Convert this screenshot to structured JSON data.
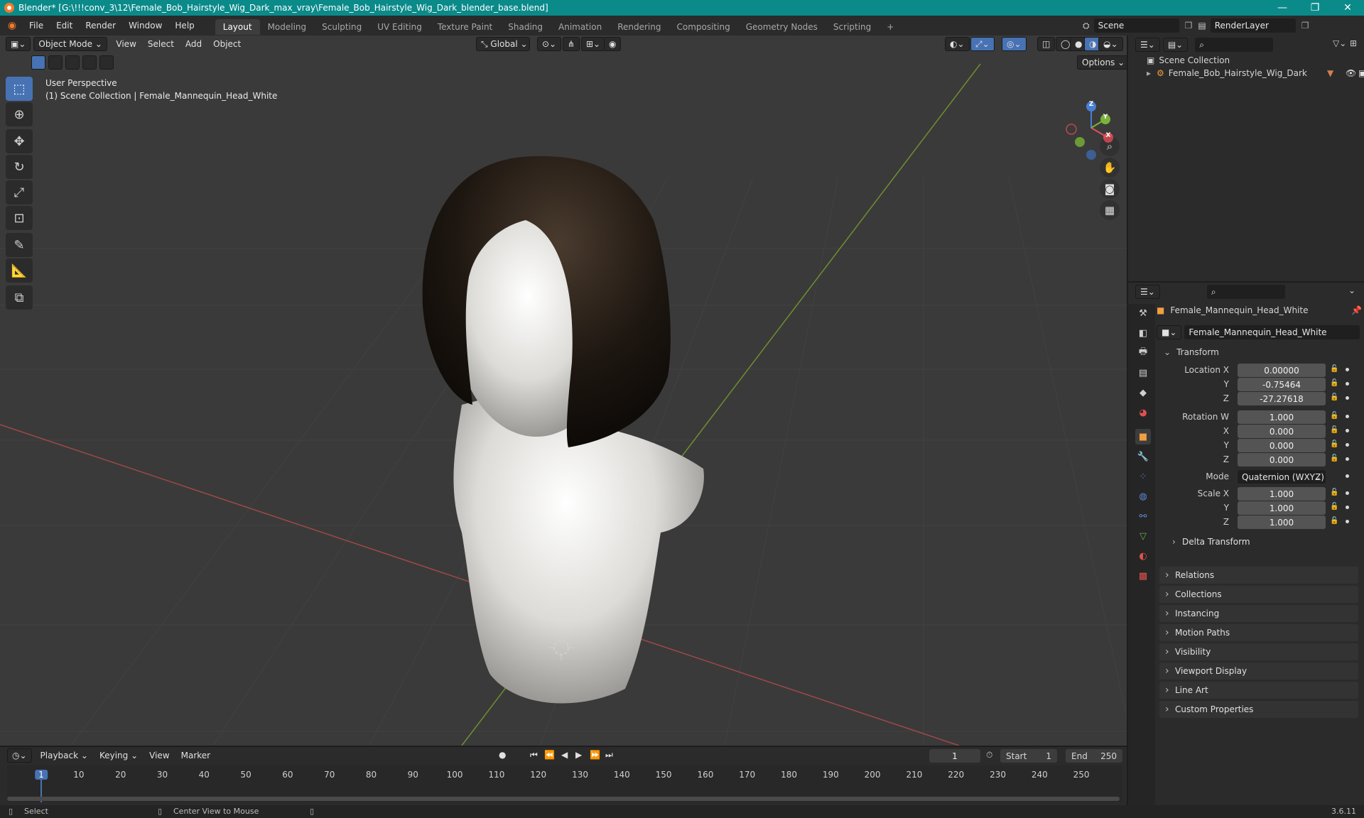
{
  "window": {
    "title": "Blender* [G:\\!!!conv_3\\12\\Female_Bob_Hairstyle_Wig_Dark_max_vray\\Female_Bob_Hairstyle_Wig_Dark_blender_base.blend]",
    "minimize": "—",
    "maximize": "❐",
    "close": "✕"
  },
  "menu": {
    "items": [
      "File",
      "Edit",
      "Render",
      "Window",
      "Help"
    ],
    "workspaces": [
      "Layout",
      "Modeling",
      "Sculpting",
      "UV Editing",
      "Texture Paint",
      "Shading",
      "Animation",
      "Rendering",
      "Compositing",
      "Geometry Nodes",
      "Scripting"
    ],
    "add_tab": "+",
    "scene": "Scene",
    "render_layer": "RenderLayer"
  },
  "viewport": {
    "mode": "Object Mode",
    "menus": [
      "View",
      "Select",
      "Add",
      "Object"
    ],
    "transform_orientation": "Global",
    "options": "Options",
    "perspective": "User Perspective",
    "collection_info": "(1) Scene Collection | Female_Mannequin_Head_White",
    "gizmo": {
      "z": "Z",
      "y": "Y",
      "x": "X"
    }
  },
  "outliner": {
    "root": "Scene Collection",
    "item": "Female_Bob_Hairstyle_Wig_Dark"
  },
  "properties": {
    "object_name": "Female_Mannequin_Head_White",
    "object_field": "Female_Mannequin_Head_White",
    "transform": {
      "title": "Transform",
      "location": {
        "label": "Location X",
        "x": "0.00000",
        "y": "-0.75464",
        "z": "-27.27618"
      },
      "rotation": {
        "label": "Rotation W",
        "w": "1.000",
        "x": "0.000",
        "y": "0.000",
        "z": "0.000"
      },
      "mode_label": "Mode",
      "mode_value": "Quaternion (WXYZ)",
      "scale": {
        "label": "Scale X",
        "x": "1.000",
        "y": "1.000",
        "z": "1.000"
      },
      "axis_y": "Y",
      "axis_z": "Z",
      "axis_x": "X"
    },
    "delta": "Delta Transform",
    "sections": [
      "Relations",
      "Collections",
      "Instancing",
      "Motion Paths",
      "Visibility",
      "Viewport Display",
      "Line Art",
      "Custom Properties"
    ]
  },
  "timeline": {
    "menus": [
      "Playback",
      "Keying",
      "View",
      "Marker"
    ],
    "current_frame": "1",
    "start_label": "Start",
    "start": "1",
    "end_label": "End",
    "end": "250",
    "ticks": [
      "1",
      "10",
      "20",
      "30",
      "40",
      "50",
      "60",
      "70",
      "80",
      "90",
      "100",
      "110",
      "120",
      "130",
      "140",
      "150",
      "160",
      "170",
      "180",
      "190",
      "200",
      "210",
      "220",
      "230",
      "240",
      "250"
    ]
  },
  "status": {
    "select": "Select",
    "center_view": "Center View to Mouse",
    "version": "3.6.11"
  },
  "colors": {
    "accent": "#4772b3",
    "titlebar": "#0b8a8a",
    "orange": "#f5792a"
  }
}
